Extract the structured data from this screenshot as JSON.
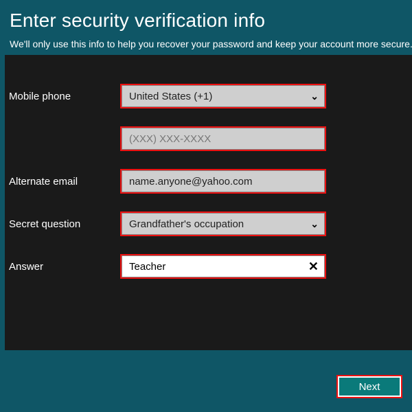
{
  "header": {
    "title": "Enter security verification info",
    "subtitle": "We'll only use this info to help you recover your password and keep your account more secure."
  },
  "form": {
    "mobile_label": "Mobile phone",
    "country_selected": "United States (+1)",
    "phone_placeholder": "(XXX) XXX-XXXX",
    "alt_email_label": "Alternate email",
    "alt_email_value": "name.anyone@yahoo.com",
    "secret_q_label": "Secret question",
    "secret_q_selected": "Grandfather's occupation",
    "answer_label": "Answer",
    "answer_value": "Teacher"
  },
  "footer": {
    "next_label": "Next"
  }
}
